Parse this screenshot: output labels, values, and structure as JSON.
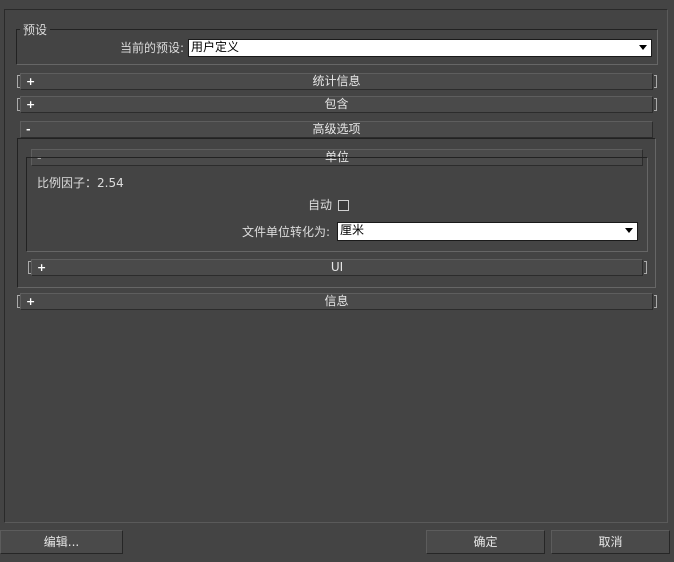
{
  "preset": {
    "group_title": "预设",
    "label": "当前的预设:",
    "value": "用户定义"
  },
  "rollouts": {
    "stats": {
      "sign": "+",
      "title": "统计信息"
    },
    "include": {
      "sign": "+",
      "title": "包含"
    },
    "advanced": {
      "sign": "-",
      "title": "高级选项"
    },
    "units": {
      "sign": "-",
      "title": "单位"
    },
    "ui": {
      "sign": "+",
      "title": "UI"
    },
    "info": {
      "sign": "+",
      "title": "信息"
    }
  },
  "units": {
    "scale_factor": "比例因子：2.54",
    "auto_label": "自动",
    "auto_checked": false,
    "convert_label": "文件单位转化为:",
    "convert_value": "厘米"
  },
  "buttons": {
    "edit": "编辑...",
    "ok": "确定",
    "cancel": "取消"
  }
}
